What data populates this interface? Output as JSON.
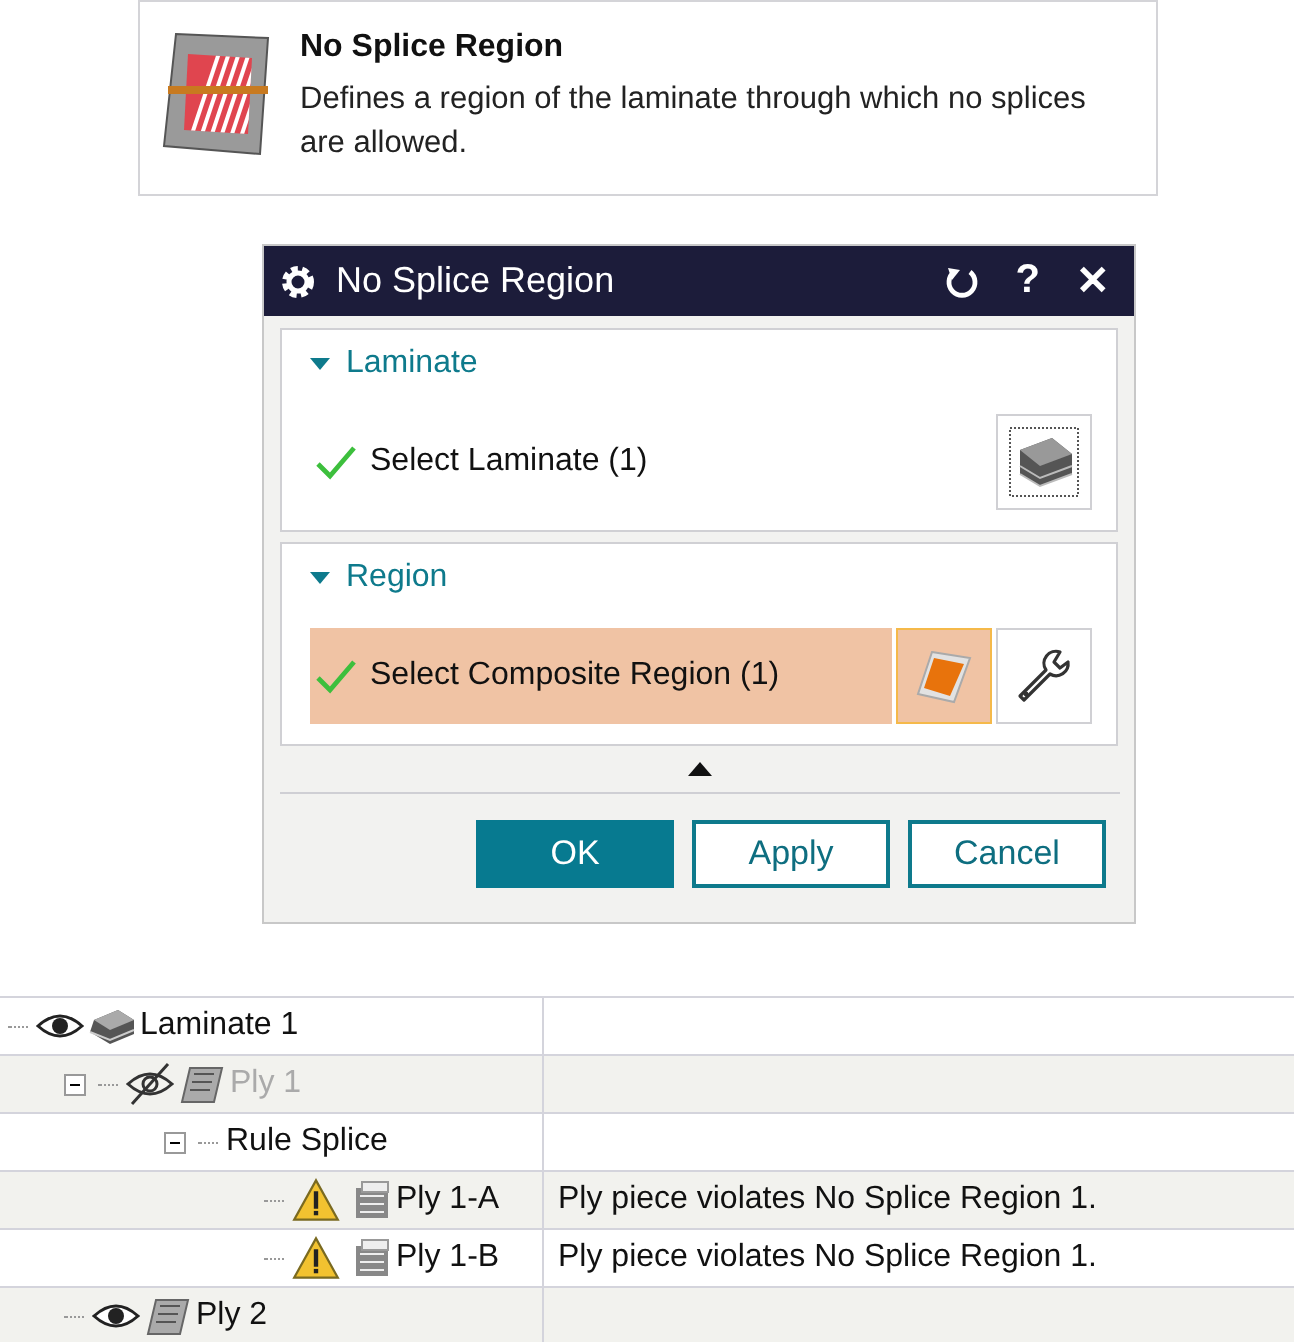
{
  "tooltip": {
    "title": "No Splice Region",
    "description": "Defines a region of the laminate through which no splices are allowed."
  },
  "dialog": {
    "title": "No Splice Region",
    "title_buttons": [
      {
        "kind": "reset"
      },
      {
        "kind": "text",
        "label": "?"
      },
      {
        "kind": "text",
        "label": "✕"
      }
    ],
    "groups": [
      {
        "title": "Laminate",
        "expanded": true,
        "selection": {
          "label": "Select Laminate (1)",
          "complete": true,
          "selected": false
        },
        "tools": [
          {
            "kind": "laminate",
            "active": false
          }
        ]
      },
      {
        "title": "Region",
        "expanded": true,
        "selection": {
          "label": "Select Composite Region (1)",
          "complete": true,
          "selected": true
        },
        "tools": [
          {
            "kind": "region",
            "active": true
          },
          {
            "kind": "wrench",
            "active": false
          }
        ]
      }
    ],
    "buttons": [
      {
        "label": "OK",
        "kind": "primary"
      },
      {
        "label": "Apply",
        "kind": "normal"
      },
      {
        "label": "Cancel",
        "kind": "normal"
      }
    ]
  },
  "tree": [
    {
      "label": "Laminate 1",
      "kind": "laminate",
      "visible": true,
      "children": [
        {
          "label": "Ply 1",
          "kind": "ply",
          "visible": false,
          "expanded": true,
          "children": [
            {
              "label": "Rule Splice",
              "kind": "rule",
              "expanded": true,
              "children": [
                {
                  "label": "Ply 1-A",
                  "kind": "piece",
                  "message": "Ply piece violates No Splice Region 1."
                },
                {
                  "label": "Ply 1-B",
                  "kind": "piece",
                  "message": "Ply piece violates No Splice Region 1."
                }
              ]
            }
          ]
        },
        {
          "label": "Ply 2",
          "kind": "ply",
          "visible": true
        }
      ]
    }
  ]
}
